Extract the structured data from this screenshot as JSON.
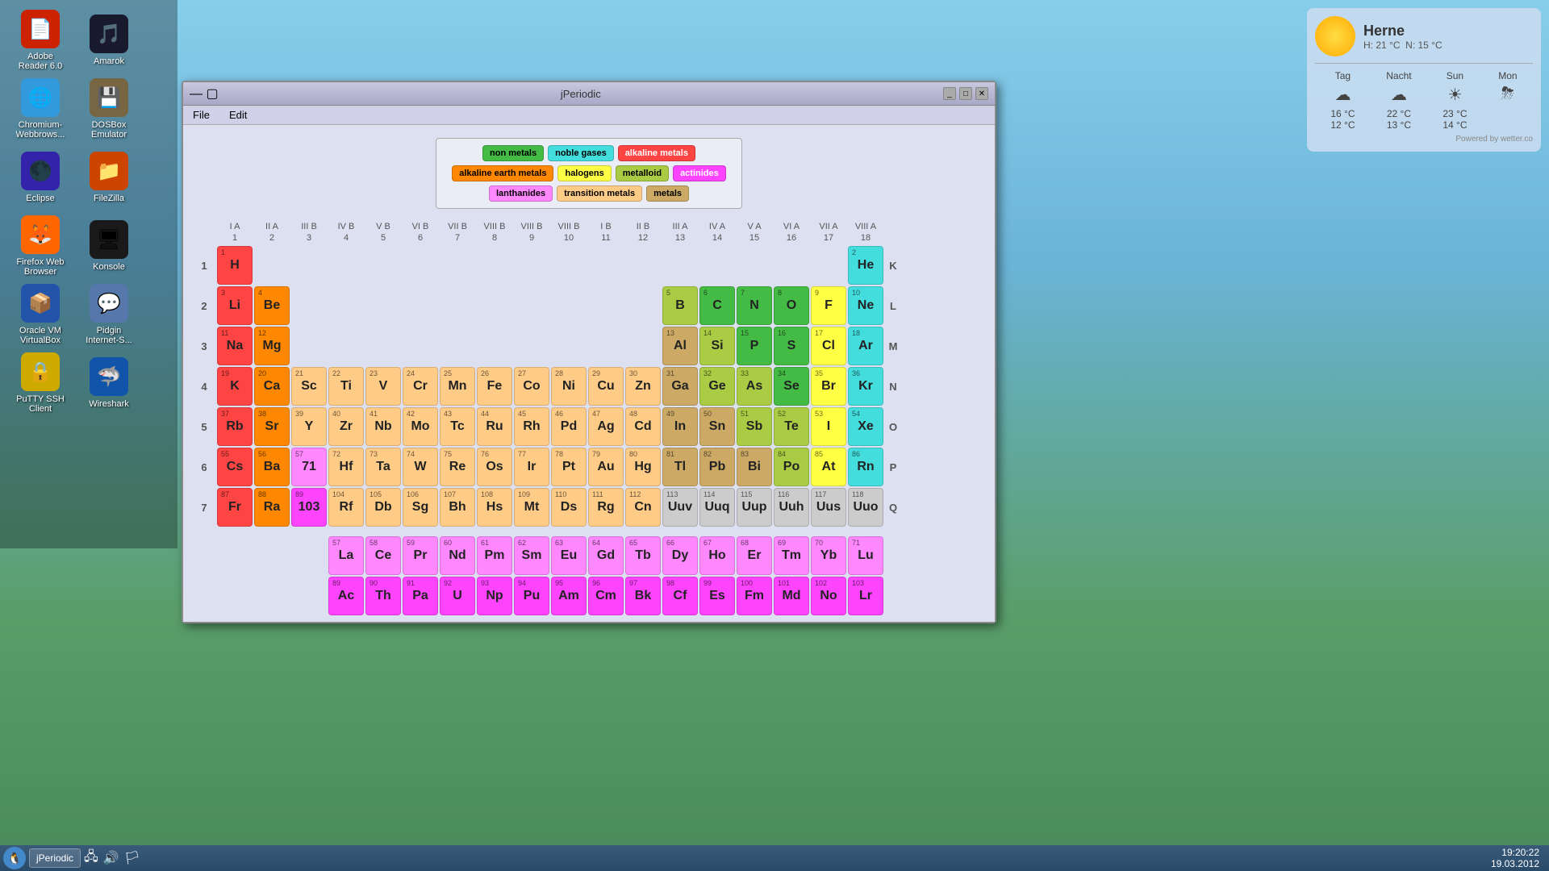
{
  "desktop": {
    "icons": [
      {
        "id": "adobe",
        "label": "Adobe\nReader 6.0",
        "icon": "📄",
        "color": "#cc0000"
      },
      {
        "id": "amarok",
        "label": "Amarok",
        "icon": "🎵",
        "color": "#1a1a2e"
      },
      {
        "id": "chromium",
        "label": "Chromium-\nWebbrows...",
        "icon": "🌐",
        "color": "#4488cc"
      },
      {
        "id": "dosbox",
        "label": "DOSBox\nEmulator",
        "icon": "💾",
        "color": "#888844"
      },
      {
        "id": "eclipse",
        "label": "Eclipse",
        "icon": "🌑",
        "color": "#5533aa"
      },
      {
        "id": "filezilla",
        "label": "FileZilla",
        "icon": "📁",
        "color": "#cc4400"
      },
      {
        "id": "firefox",
        "label": "Firefox Web\nBrowser",
        "icon": "🦊",
        "color": "#ff6600"
      },
      {
        "id": "konsole",
        "label": "Konsole",
        "icon": "🖥",
        "color": "#1a1a1a"
      },
      {
        "id": "oracle",
        "label": "Oracle VM\nVirtualBox",
        "icon": "📦",
        "color": "#2255aa"
      },
      {
        "id": "pidgin",
        "label": "Pidgin\nInternet-S...",
        "icon": "💬",
        "color": "#5577aa"
      },
      {
        "id": "putty",
        "label": "PuTTY SSH\nClient",
        "icon": "🔒",
        "color": "#ccaa00"
      },
      {
        "id": "wireshark",
        "label": "Wireshark",
        "icon": "🦈",
        "color": "#1155aa"
      }
    ]
  },
  "weather": {
    "city": "Herne",
    "temp_high": "H: 21 °C",
    "temp_low": "N: 15 °C",
    "powered": "Powered by wetter.co",
    "days": [
      {
        "label": "Tag",
        "icon": "☁",
        "day_temp": "16 °C",
        "night_temp": "12 °C"
      },
      {
        "label": "Nacht",
        "icon": "☁",
        "day_temp": "22 °C",
        "night_temp": "13 °C"
      },
      {
        "label": "Sun",
        "icon": "☀",
        "day_temp": "23 °C",
        "night_temp": "14 °C"
      },
      {
        "label": "Mon",
        "icon": "⛈",
        "day_temp": "",
        "night_temp": ""
      }
    ]
  },
  "window": {
    "title": "jPeriodic",
    "menu_file": "File",
    "menu_edit": "Edit"
  },
  "legend": {
    "items": [
      {
        "label": "non metals",
        "class": "c-nonmetal"
      },
      {
        "label": "noble gases",
        "class": "c-noble"
      },
      {
        "label": "alkaline metals",
        "class": "c-alkali"
      },
      {
        "label": "alkaline earth metals",
        "class": "c-alkaline"
      },
      {
        "label": "halogens",
        "class": "c-halogen"
      },
      {
        "label": "metalloid",
        "class": "c-metalloid"
      },
      {
        "label": "actinides",
        "class": "c-actinide"
      },
      {
        "label": "lanthanides",
        "class": "c-lanthanide"
      },
      {
        "label": "transition metals",
        "class": "c-transition"
      },
      {
        "label": "metals",
        "class": "c-metal"
      }
    ]
  },
  "groups": [
    "I A",
    "II A",
    "III B",
    "IV B",
    "V B",
    "VI B",
    "VII B",
    "VIII B",
    "VIII B",
    "VIII B",
    "I B",
    "II B",
    "III A",
    "IV A",
    "V A",
    "VI A",
    "VII A",
    "VIII A"
  ],
  "group_nums": [
    "1",
    "2",
    "3",
    "4",
    "5",
    "6",
    "7",
    "8",
    "9",
    "10",
    "11",
    "12",
    "13",
    "14",
    "15",
    "16",
    "17",
    "18"
  ],
  "periods": [
    "1",
    "2",
    "3",
    "4",
    "5",
    "6",
    "7"
  ],
  "period_letters": [
    "K",
    "L",
    "M",
    "N",
    "O",
    "P",
    "Q"
  ],
  "taskbar": {
    "time": "19:20:22",
    "date": "19.03.2012",
    "jperiodic_label": "jPeriodic"
  }
}
